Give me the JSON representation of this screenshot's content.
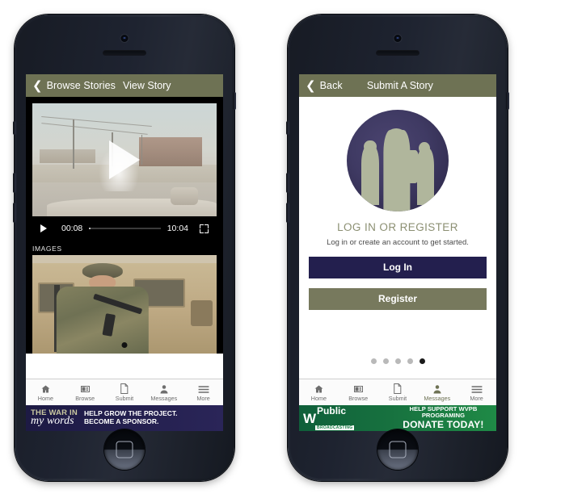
{
  "left_phone": {
    "navbar": {
      "back_label": "Browse Stories",
      "title": "View Story",
      "back_icon": "chevron-left-icon"
    },
    "video": {
      "play_overlay_icon": "play-triangle-icon",
      "play_icon": "play-icon",
      "current_time": "00:08",
      "duration": "10:04",
      "fullscreen_icon": "fullscreen-icon"
    },
    "images_section": {
      "label": "IMAGES"
    },
    "tabbar": [
      {
        "icon": "home-icon",
        "label": "Home",
        "active": false
      },
      {
        "icon": "browse-icon",
        "label": "Browse",
        "active": false
      },
      {
        "icon": "submit-icon",
        "label": "Submit",
        "active": false
      },
      {
        "icon": "messages-icon",
        "label": "Messages",
        "active": false
      },
      {
        "icon": "more-icon",
        "label": "More",
        "active": false
      }
    ],
    "ad": {
      "logo_line1": "THE WAR IN",
      "logo_line2": "my words",
      "text_line1": "HELP GROW THE PROJECT.",
      "text_line2": "BECOME A SPONSOR."
    }
  },
  "right_phone": {
    "navbar": {
      "back_label": "Back",
      "title": "Submit A Story",
      "back_icon": "chevron-left-icon"
    },
    "logo": {
      "name": "soldiers-silhouette-logo",
      "circle_color": "#3a3560",
      "silhouette_color": "#b0b69c"
    },
    "login": {
      "heading": "LOG IN OR REGISTER",
      "subtext": "Log in or create an account to get started.",
      "login_button": "Log In",
      "register_button": "Register",
      "login_button_color": "#231f4e",
      "register_button_color": "#77795d"
    },
    "pager": {
      "total": 5,
      "active_index": 4
    },
    "tabbar": [
      {
        "icon": "home-icon",
        "label": "Home",
        "active": false
      },
      {
        "icon": "browse-icon",
        "label": "Browse",
        "active": false
      },
      {
        "icon": "submit-icon",
        "label": "Submit",
        "active": false
      },
      {
        "icon": "messages-icon",
        "label": "Messages",
        "active": true
      },
      {
        "icon": "more-icon",
        "label": "More",
        "active": false
      }
    ],
    "ad": {
      "logo_w": "W",
      "logo_public": "Public",
      "logo_broadcasting": "BROADCASTING",
      "text_line1": "HELP SUPPORT WVPB PROGRAMING",
      "text_line2": "DONATE TODAY!"
    }
  },
  "theme": {
    "navbar_color": "#6e7254",
    "accent_navy": "#231f4e"
  }
}
